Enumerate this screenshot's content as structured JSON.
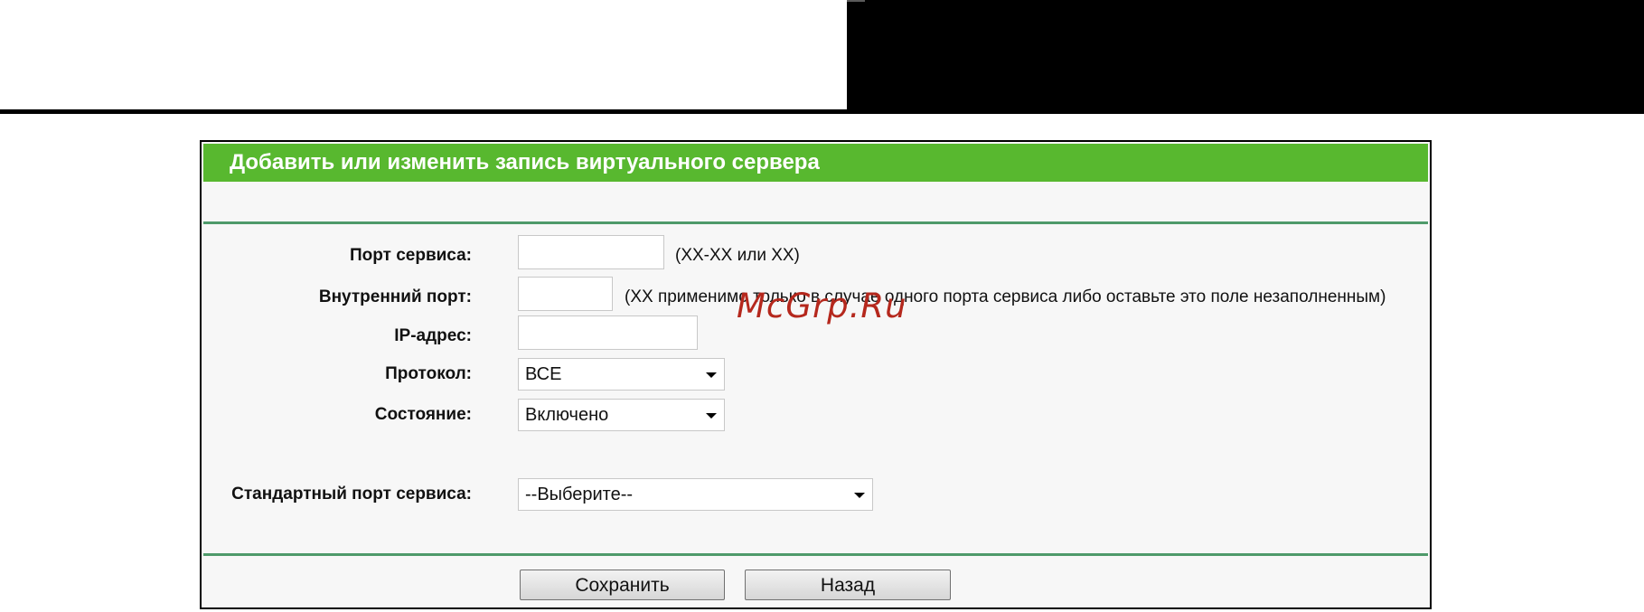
{
  "page_title": "Добавить или изменить запись виртуального сервера",
  "fields": {
    "service_port": {
      "label": "Порт сервиса:",
      "value": "",
      "hint": "(XX-XX или XX)"
    },
    "internal_port": {
      "label": "Внутренний порт:",
      "value": "",
      "hint": "(XX применимо только в случае одного порта сервиса либо оставьте это поле незаполненным)"
    },
    "ip_address": {
      "label": "IP-адрес:",
      "value": ""
    },
    "protocol": {
      "label": "Протокол:",
      "selected": "ВСЕ"
    },
    "status": {
      "label": "Состояние:",
      "selected": "Включено"
    },
    "common_service_port": {
      "label": "Стандартный порт сервиса:",
      "selected": "--Выберите--"
    }
  },
  "buttons": {
    "save": "Сохранить",
    "back": "Назад"
  },
  "watermark": "McGrp.Ru",
  "colors": {
    "header_green": "#58b82f",
    "separator": "#4e9a6a",
    "watermark_red": "#b5281d"
  }
}
